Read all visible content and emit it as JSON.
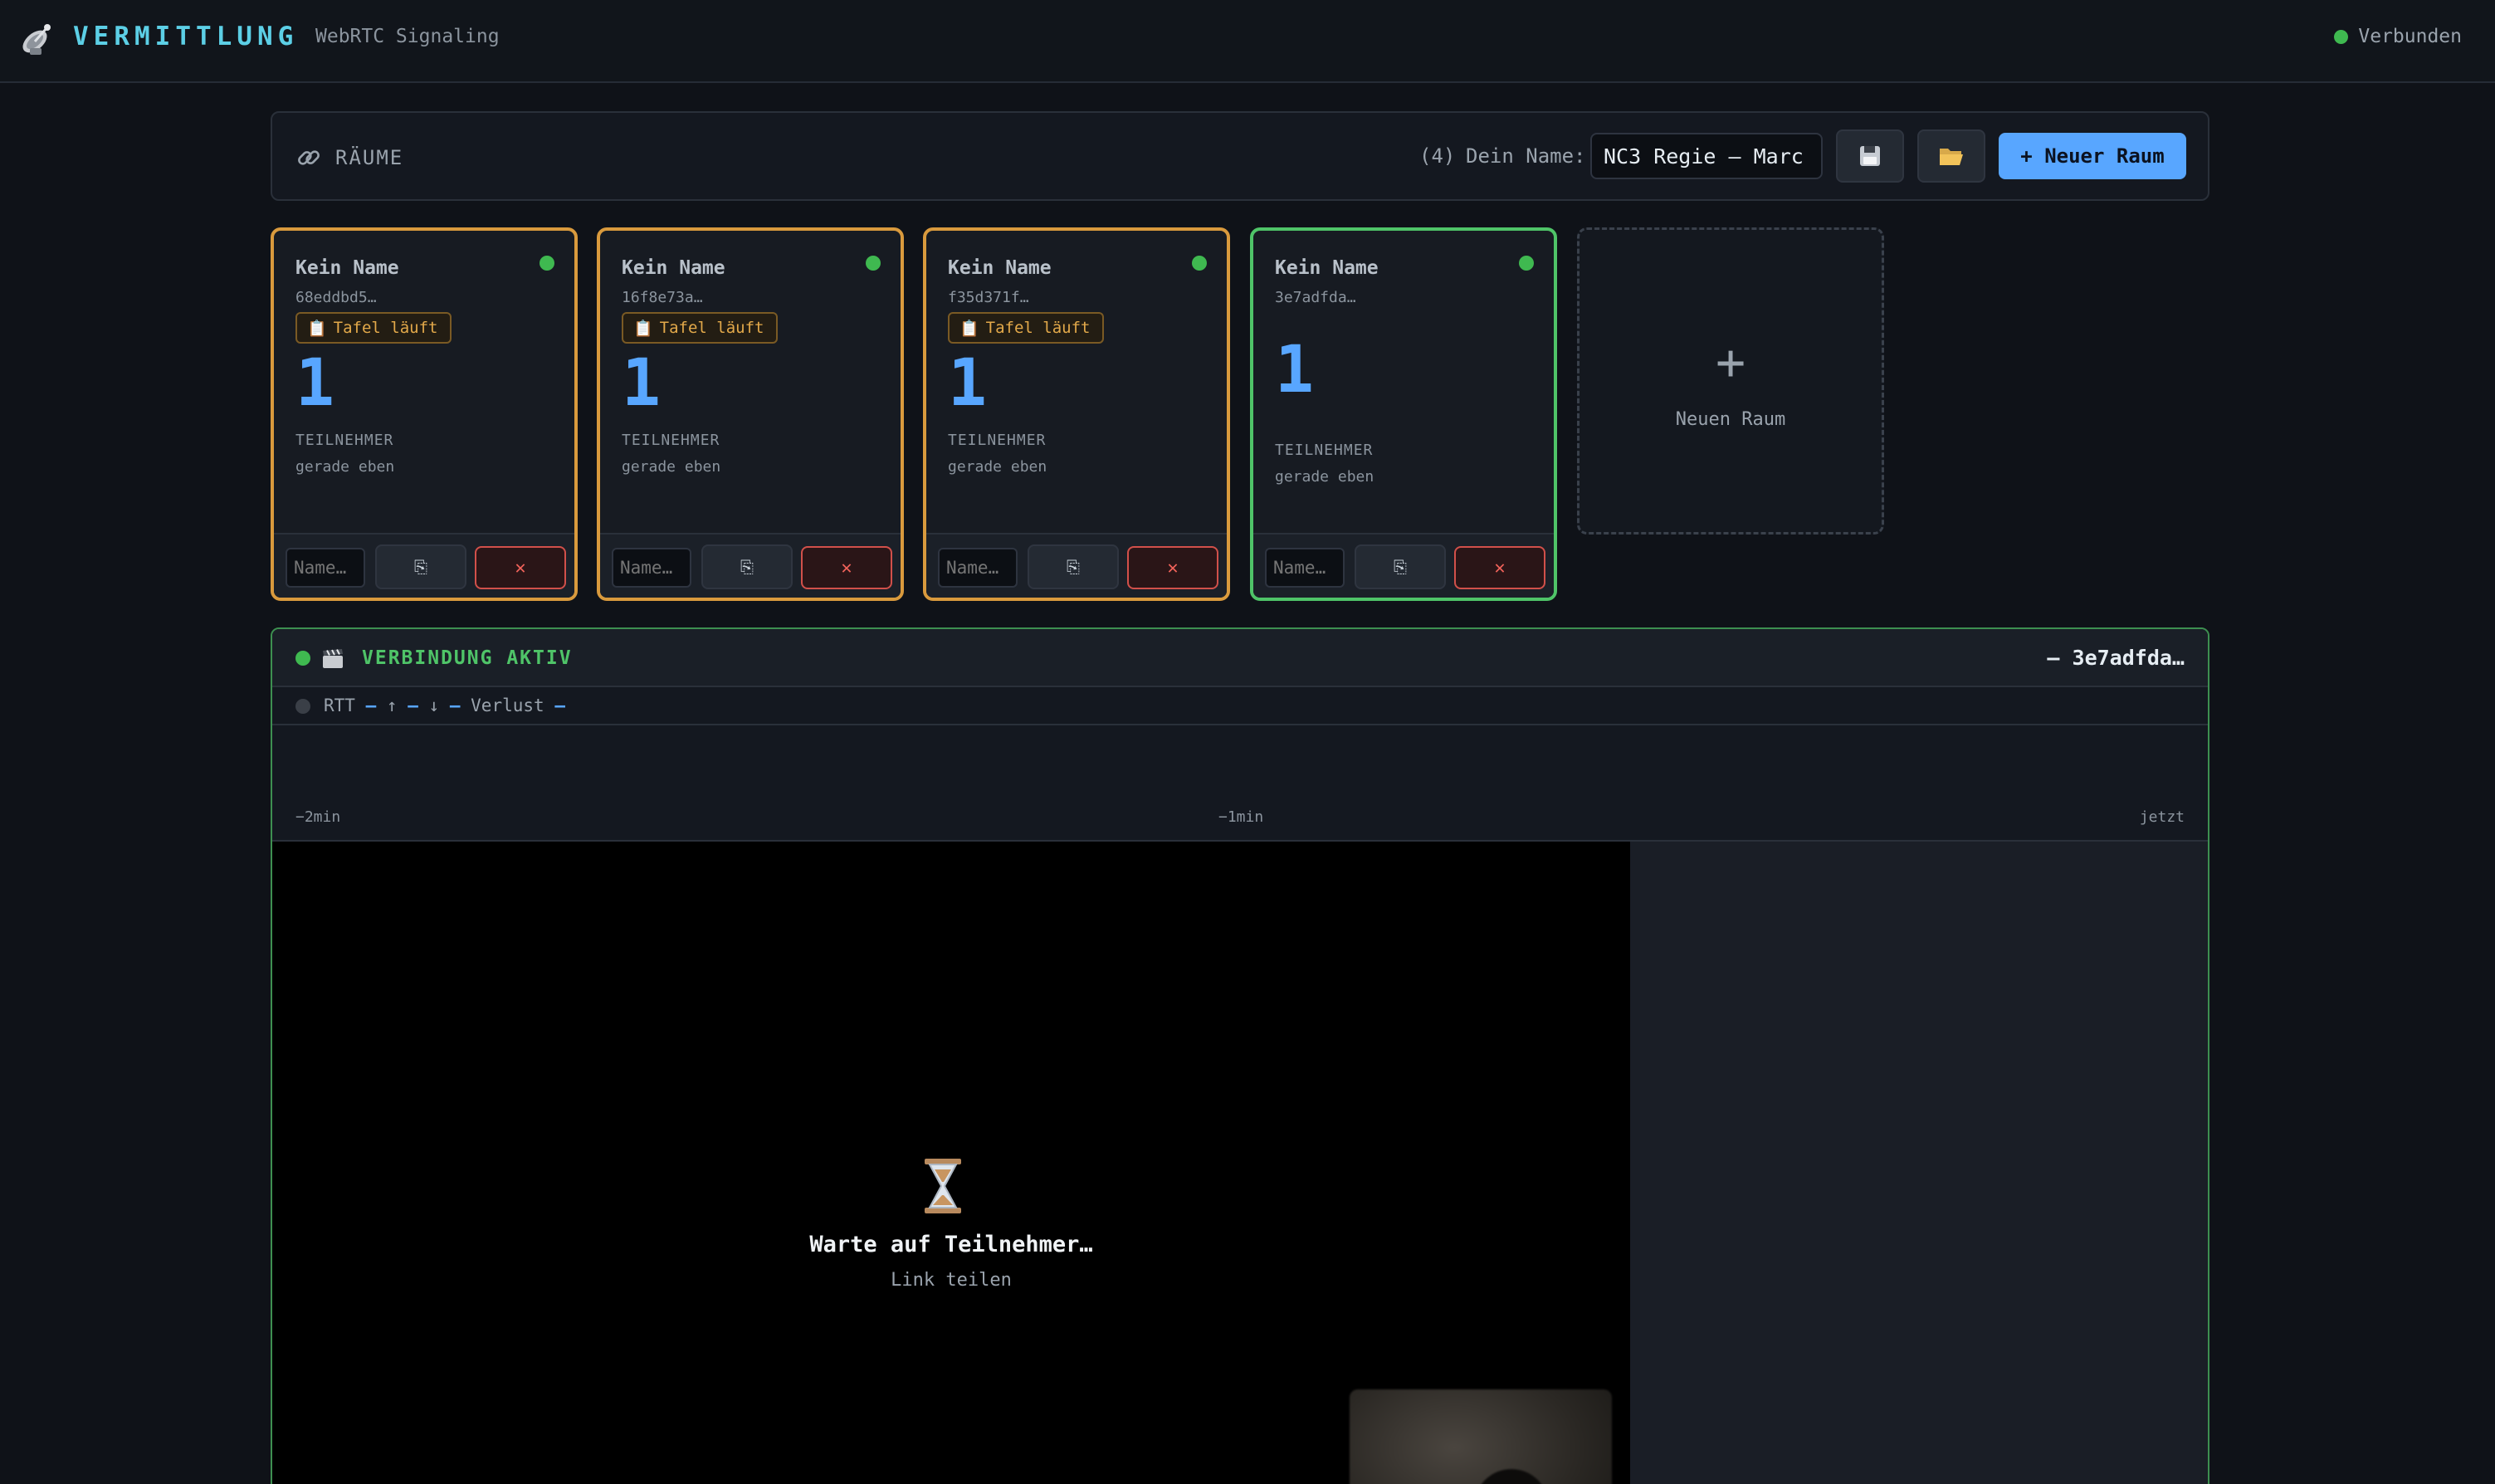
{
  "header": {
    "brand": "VERMITTLUNG",
    "subtitle": "WebRTC Signaling",
    "status": "Verbunden",
    "status_color": "#3fb950"
  },
  "rooms_panel": {
    "title": "RÄUME",
    "count": "(4)",
    "name_label": "Dein Name:",
    "name_value": "NC3 Regie – Marc",
    "save_icon": "floppy-disk-icon",
    "open_icon": "folder-open-icon",
    "new_room_label": "+ Neuer Raum"
  },
  "rooms": [
    {
      "name": "Kein Name",
      "id": "68eddbd5…",
      "badge": "Tafel läuft",
      "count": "1",
      "count_label": "TEILNEHMER",
      "time": "gerade eben",
      "name_placeholder": "Name…",
      "copy_icon": "copy-icon",
      "delete_label": "✕",
      "active": false
    },
    {
      "name": "Kein Name",
      "id": "16f8e73a…",
      "badge": "Tafel läuft",
      "count": "1",
      "count_label": "TEILNEHMER",
      "time": "gerade eben",
      "name_placeholder": "Name…",
      "copy_icon": "copy-icon",
      "delete_label": "✕",
      "active": false
    },
    {
      "name": "Kein Name",
      "id": "f35d371f…",
      "badge": "Tafel läuft",
      "count": "1",
      "count_label": "TEILNEHMER",
      "time": "gerade eben",
      "name_placeholder": "Name…",
      "copy_icon": "copy-icon",
      "delete_label": "✕",
      "active": false
    },
    {
      "name": "Kein Name",
      "id": "3e7adfda…",
      "count": "1",
      "count_label": "TEILNEHMER",
      "time": "gerade eben",
      "name_placeholder": "Name…",
      "copy_icon": "copy-icon",
      "delete_label": "✕",
      "active": true
    }
  ],
  "new_room_card": {
    "plus": "+",
    "label": "Neuen Raum"
  },
  "connection": {
    "title": "VERBINDUNG AKTIV",
    "room": "– 3e7adfda…",
    "stats": {
      "rtt_label": "RTT",
      "rtt": "–",
      "up_label": "↑",
      "up": "–",
      "down_label": "↓",
      "down": "–",
      "loss_label": "Verlust",
      "loss": "–"
    },
    "graph_ticks": [
      "−2min",
      "−1min",
      "jetzt"
    ],
    "waiting_title": "Warte auf Teilnehmer…",
    "waiting_sub": "Link teilen",
    "accent": "#4fc468"
  }
}
